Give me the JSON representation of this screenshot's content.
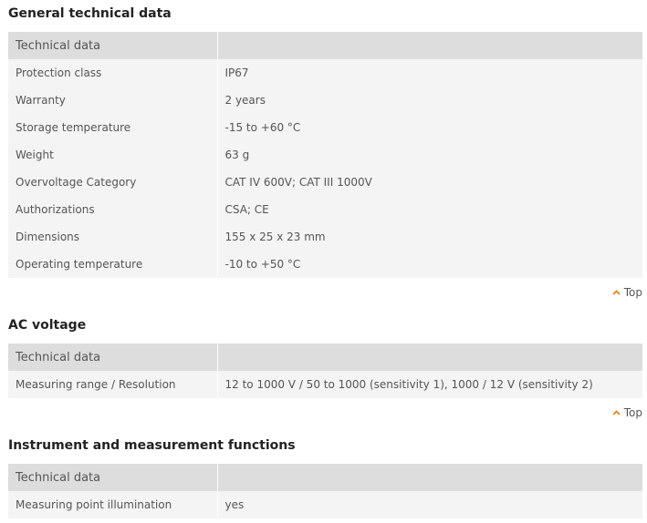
{
  "sections": [
    {
      "title": "General technical data",
      "header": [
        "Technical data",
        ""
      ],
      "rows": [
        [
          "Protection class",
          "IP67"
        ],
        [
          "Warranty",
          "2 years"
        ],
        [
          "Storage temperature",
          "-15 to +60 °C"
        ],
        [
          "Weight",
          "63 g"
        ],
        [
          "Overvoltage Category",
          "CAT IV 600V; CAT III 1000V"
        ],
        [
          "Authorizations",
          "CSA; CE"
        ],
        [
          "Dimensions",
          "155 x 25 x 23 mm"
        ],
        [
          "Operating temperature",
          "-10 to +50 °C"
        ]
      ],
      "top_label": "Top"
    },
    {
      "title": "AC voltage",
      "header": [
        "Technical data",
        ""
      ],
      "rows": [
        [
          "Measuring range / Resolution",
          "12 to 1000 V / 50 to 1000 (sensitivity 1), 1000 / 12 V (sensitivity 2)"
        ]
      ],
      "top_label": "Top"
    },
    {
      "title": "Instrument and measurement functions",
      "header": [
        "Technical data",
        ""
      ],
      "rows": [
        [
          "Measuring point illumination",
          "yes"
        ]
      ]
    }
  ],
  "colors": {
    "accent": "#f07800",
    "header_bg": "#dddddd",
    "row_bg": "#f4f4f4",
    "text": "#555555",
    "title": "#222222"
  },
  "icons": {
    "top_arrow": "chevron-up-icon"
  }
}
